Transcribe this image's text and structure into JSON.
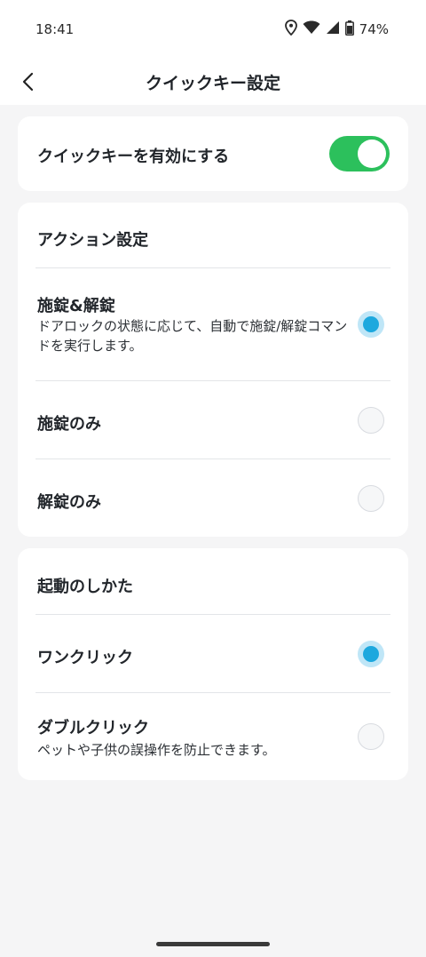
{
  "status_bar": {
    "time": "18:41",
    "battery": "74%"
  },
  "header": {
    "title": "クイックキー設定"
  },
  "quick_key": {
    "label": "クイックキーを有効にする",
    "enabled": true
  },
  "action_settings": {
    "title": "アクション設定",
    "options": [
      {
        "label": "施錠&解錠",
        "description": "ドアロックの状態に応じて、自動で施錠/解錠コマンドを実行します。",
        "selected": true
      },
      {
        "label": "施錠のみ",
        "selected": false
      },
      {
        "label": "解錠のみ",
        "selected": false
      }
    ]
  },
  "activation": {
    "title": "起動のしかた",
    "options": [
      {
        "label": "ワンクリック",
        "selected": true
      },
      {
        "label": "ダブルクリック",
        "description": "ペットや子供の誤操作を防止できます。",
        "selected": false
      }
    ]
  },
  "colors": {
    "toggle_on": "#2cc05c",
    "radio_selected": "#1ca8de",
    "background": "#f5f5f6"
  }
}
